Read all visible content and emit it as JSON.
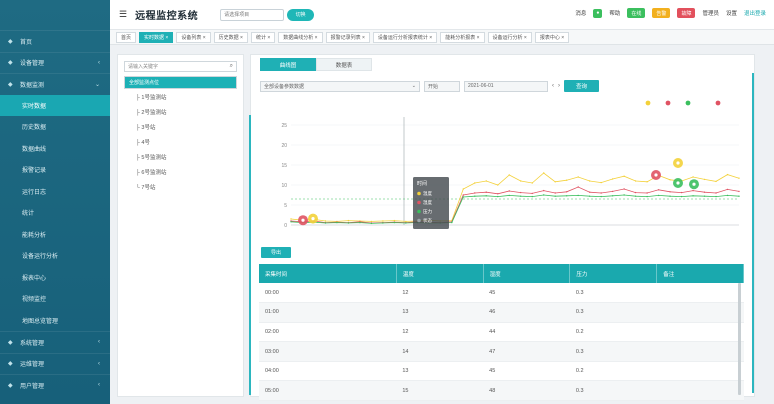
{
  "app": {
    "title": "远程监控系统"
  },
  "header": {
    "project_placeholder": "请选择项目",
    "project_button": "切换",
    "right_links": [
      "消息",
      "帮助"
    ],
    "badges": [
      {
        "label": "在线",
        "color": "#3bbf5e"
      },
      {
        "label": "告警",
        "color": "#f2b01e"
      },
      {
        "label": "故障",
        "color": "#e2505c"
      }
    ],
    "user": "管理员",
    "settings": "设置",
    "logout": "退出登录"
  },
  "sidebar": {
    "items": [
      {
        "label": "首页",
        "icon": "home-icon",
        "level": 0
      },
      {
        "label": "设备管理",
        "icon": "device-icon",
        "level": 0,
        "arrow": "‹"
      },
      {
        "label": "数据监测",
        "icon": "monitor-icon",
        "level": 0,
        "arrow": "⌄"
      },
      {
        "label": "实时数据",
        "level": 1,
        "active": true
      },
      {
        "label": "历史数据",
        "level": 1
      },
      {
        "label": "数据曲线",
        "level": 1
      },
      {
        "label": "报警记录",
        "level": 1
      },
      {
        "label": "运行日志",
        "level": 1
      },
      {
        "label": "统计",
        "level": 1
      },
      {
        "label": "能耗分析",
        "level": 1
      },
      {
        "label": "设备运行分析",
        "level": 1
      },
      {
        "label": "报表中心",
        "level": 1
      },
      {
        "label": "视频监控",
        "level": 1
      },
      {
        "label": "地图总览管理",
        "level": 1
      },
      {
        "label": "系统管理",
        "icon": "settings-icon",
        "level": 0,
        "arrow": "‹"
      },
      {
        "label": "运维管理",
        "icon": "tools-icon",
        "level": 0,
        "arrow": "‹"
      },
      {
        "label": "用户管理",
        "icon": "user-icon",
        "level": 0,
        "arrow": "‹"
      }
    ]
  },
  "tabs": [
    "首页",
    "实时数据 ×",
    "设备列表 ×",
    "历史数据 ×",
    "统计 ×",
    "数据曲线分析 ×",
    "报警记录列表 ×",
    "设备运行分析报表统计 ×",
    "能耗分析报表 ×",
    "设备运行分析 ×",
    "报表中心 ×"
  ],
  "tree": {
    "search_placeholder": "请输入关键字",
    "nodes": [
      {
        "label": "全部监测点位",
        "selected": true
      },
      {
        "label": "├ 1号监测站"
      },
      {
        "label": "├ 2号监测站"
      },
      {
        "label": "├ 3号站"
      },
      {
        "label": "├ 4号"
      },
      {
        "label": "├ 5号监测站"
      },
      {
        "label": "├ 6号监测站"
      },
      {
        "label": "└ 7号站"
      }
    ]
  },
  "main": {
    "view_tabs": [
      "曲线图",
      "数据表"
    ],
    "filter": {
      "device": "全部设备参数数据",
      "start_label": "开始",
      "date": "2021-06-01",
      "query": "查询"
    },
    "export": "导出",
    "table": {
      "columns": [
        "采集时间",
        "温度",
        "湿度",
        "压力",
        "备注"
      ],
      "rows": [
        [
          "00:00",
          "12",
          "45",
          "0.3",
          ""
        ],
        [
          "01:00",
          "13",
          "46",
          "0.3",
          ""
        ],
        [
          "02:00",
          "12",
          "44",
          "0.2",
          ""
        ],
        [
          "03:00",
          "14",
          "47",
          "0.3",
          ""
        ],
        [
          "04:00",
          "13",
          "45",
          "0.2",
          ""
        ],
        [
          "05:00",
          "15",
          "48",
          "0.3",
          ""
        ]
      ]
    }
  },
  "chart_data": {
    "type": "line",
    "title": "",
    "yticks": [
      "25",
      "20",
      "15",
      "10",
      "5",
      "0"
    ],
    "ylim": [
      0,
      25
    ],
    "grid": true,
    "legend": "tooltip",
    "series": [
      {
        "name": "",
        "color": "#f3d13a",
        "values": [
          1.5,
          1.2,
          1.4,
          1.0,
          0.9,
          1.1,
          1.0,
          0.9,
          1.0,
          1.1,
          0.9,
          1.0,
          1.2,
          1.0,
          1.1,
          9.0,
          10.5,
          11.0,
          10.0,
          12.5,
          11.0,
          10.5,
          13.0,
          10.8,
          11.2,
          12.0,
          11.0,
          10.6,
          11.5,
          12.2,
          11.0,
          10.8,
          12.4,
          11.3,
          11.0,
          12.0,
          11.4,
          10.9,
          12.6,
          11.7
        ]
      },
      {
        "name": "",
        "color": "#e05363",
        "values": [
          1.0,
          0.8,
          1.0,
          0.6,
          0.7,
          0.6,
          0.8,
          0.5,
          0.6,
          0.7,
          0.6,
          0.8,
          0.7,
          0.6,
          0.8,
          7.5,
          8.0,
          8.2,
          7.8,
          8.5,
          8.1,
          7.9,
          8.6,
          8.0,
          8.3,
          9.5,
          8.2,
          8.0,
          8.4,
          9.0,
          8.1,
          8.0,
          8.8,
          8.3,
          8.1,
          8.6,
          8.2,
          8.0,
          8.9,
          8.4
        ]
      },
      {
        "name": "",
        "color": "#3bbf5e",
        "values": [
          0.8,
          0.6,
          0.7,
          0.5,
          0.6,
          0.5,
          0.6,
          0.4,
          0.5,
          0.6,
          0.5,
          0.6,
          0.5,
          0.5,
          0.6,
          7.0,
          7.2,
          7.3,
          7.1,
          7.4,
          7.2,
          7.1,
          7.5,
          7.2,
          7.3,
          7.4,
          7.2,
          7.1,
          7.3,
          7.5,
          7.2,
          7.1,
          7.4,
          7.2,
          7.1,
          7.3,
          7.2,
          7.1,
          7.4,
          7.2
        ]
      }
    ],
    "tooltip": {
      "title": "时间",
      "items": [
        {
          "label": "温度",
          "color": "#f3d13a"
        },
        {
          "label": "湿度",
          "color": "#e05363"
        },
        {
          "label": "压力",
          "color": "#3bbf5e"
        },
        {
          "label": "状态",
          "color": "#9aa3a8"
        }
      ]
    }
  }
}
